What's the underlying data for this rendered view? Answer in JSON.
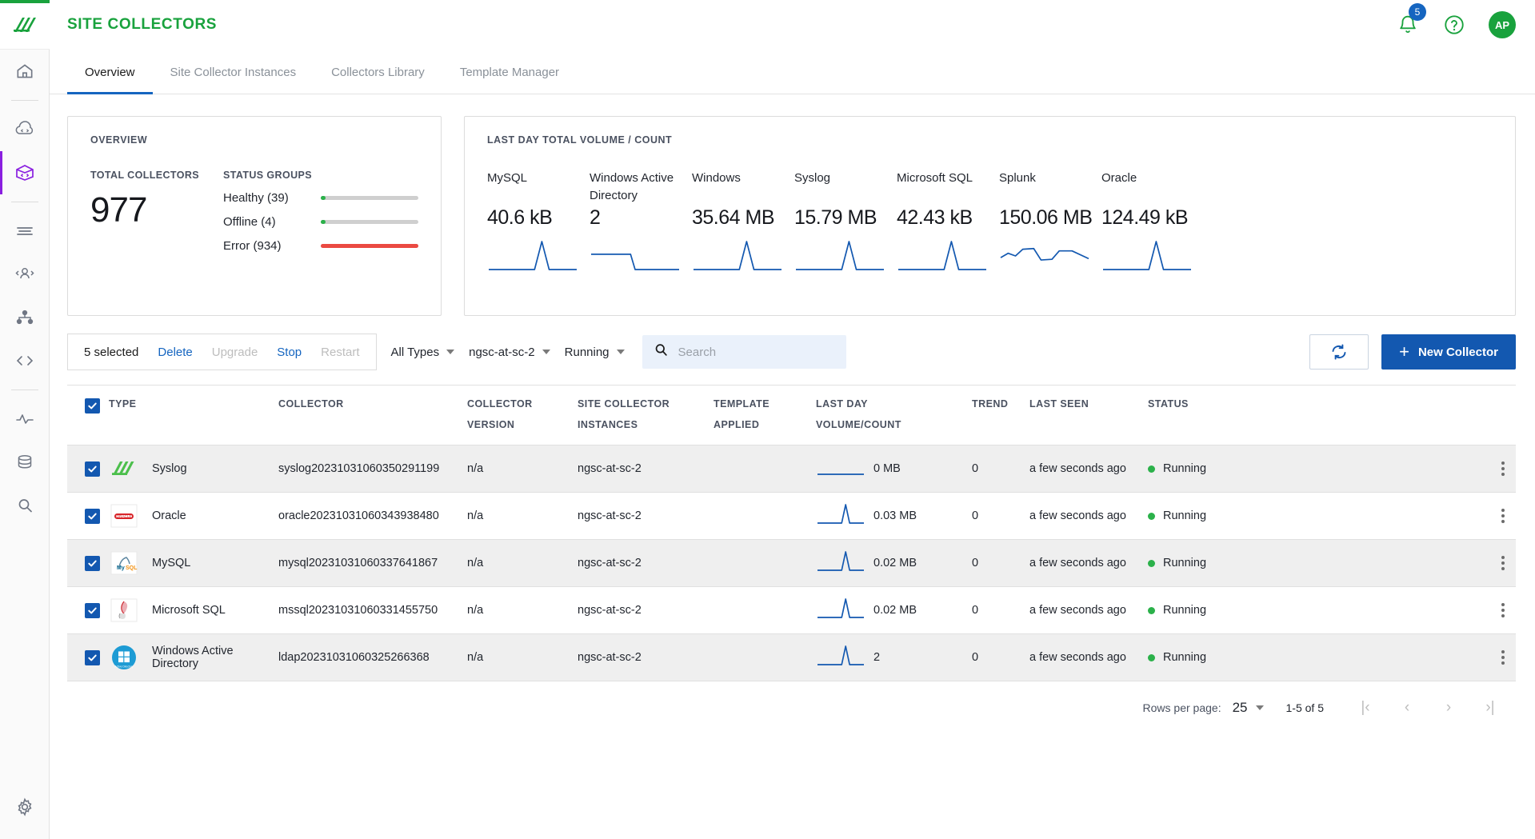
{
  "brand": {
    "accent_green": "#19a23d",
    "accent_blue": "#1358b0",
    "accent_purple": "#8a1fe0"
  },
  "header": {
    "title": "SITE COLLECTORS",
    "notification_count": "5",
    "avatar_initials": "AP",
    "bell_icon": "bell-icon",
    "help_icon": "help-circle-icon"
  },
  "sidebar": {
    "logo_icon": "logo-icon",
    "items": [
      {
        "icon": "home-icon",
        "name": "home",
        "active": false
      },
      {
        "icon": "cloud-code-icon",
        "name": "cloud",
        "active": false
      },
      {
        "icon": "box-code-icon",
        "name": "collectors",
        "active": true
      },
      {
        "icon": "list-lines-icon",
        "name": "logs",
        "active": false
      },
      {
        "icon": "users-icon",
        "name": "users",
        "active": false
      },
      {
        "icon": "topology-icon",
        "name": "topology",
        "active": false
      },
      {
        "icon": "code-brackets-icon",
        "name": "code",
        "active": false
      },
      {
        "icon": "pulse-icon",
        "name": "activity",
        "active": false
      },
      {
        "icon": "database-icon",
        "name": "database",
        "active": false
      },
      {
        "icon": "search-icon",
        "name": "search",
        "active": false
      }
    ],
    "settings_icon": "gear-icon"
  },
  "tabs": [
    {
      "label": "Overview",
      "active": true
    },
    {
      "label": "Site Collector Instances",
      "active": false
    },
    {
      "label": "Collectors Library",
      "active": false
    },
    {
      "label": "Template Manager",
      "active": false
    }
  ],
  "overview_card": {
    "title": "OVERVIEW",
    "total_label": "TOTAL COLLECTORS",
    "total_value": "977",
    "status_label": "STATUS GROUPS",
    "status_groups": [
      {
        "label": "Healthy (39)",
        "pct": 4,
        "color": "#2bb14a"
      },
      {
        "label": "Offline (4)",
        "pct": 0,
        "color": "#2bb14a"
      },
      {
        "label": "Error (934)",
        "pct": 100,
        "color": "#eb4a42"
      }
    ]
  },
  "volume_card": {
    "title": "LAST DAY TOTAL VOLUME / COUNT",
    "metrics": [
      {
        "name": "MySQL",
        "value": "40.6 kB"
      },
      {
        "name": "Windows Active Directory",
        "value": "2"
      },
      {
        "name": "Windows",
        "value": "35.64 MB"
      },
      {
        "name": "Syslog",
        "value": "15.79 MB"
      },
      {
        "name": "Microsoft SQL",
        "value": "42.43 kB"
      },
      {
        "name": "Splunk",
        "value": "150.06 MB"
      },
      {
        "name": "Oracle",
        "value": "124.49 kB"
      }
    ]
  },
  "toolbar": {
    "selected_text": "5 selected",
    "delete_label": "Delete",
    "upgrade_label": "Upgrade",
    "stop_label": "Stop",
    "restart_label": "Restart",
    "filter_type": "All Types",
    "filter_instance": "ngsc-at-sc-2",
    "filter_status": "Running",
    "search_placeholder": "Search",
    "search_value": "",
    "refresh_icon": "refresh-icon",
    "new_collector_label": "New Collector"
  },
  "table": {
    "headers": [
      {
        "main": "TYPE",
        "sub": ""
      },
      {
        "main": "COLLECTOR",
        "sub": ""
      },
      {
        "main": "COLLECTOR",
        "sub": "VERSION"
      },
      {
        "main": "SITE COLLECTOR",
        "sub": "INSTANCES"
      },
      {
        "main": "TEMPLATE",
        "sub": "APPLIED"
      },
      {
        "main": "LAST DAY",
        "sub": "VOLUME/COUNT"
      },
      {
        "main": "TREND",
        "sub": ""
      },
      {
        "main": "LAST SEEN",
        "sub": ""
      },
      {
        "main": "STATUS",
        "sub": ""
      }
    ],
    "rows": [
      {
        "checked": true,
        "icon": "syslog-logo-icon",
        "type": "Syslog",
        "collector": "syslog20231031060350291199",
        "version": "n/a",
        "instances": "ngsc-at-sc-2",
        "template": "",
        "last_day": "0 MB",
        "spark": "flat",
        "trend": "0",
        "last_seen": "a few seconds ago",
        "status": "Running"
      },
      {
        "checked": true,
        "icon": "oracle-logo-icon",
        "type": "Oracle",
        "collector": "oracle20231031060343938480",
        "version": "n/a",
        "instances": "ngsc-at-sc-2",
        "template": "",
        "last_day": "0.03 MB",
        "spark": "spike",
        "trend": "0",
        "last_seen": "a few seconds ago",
        "status": "Running"
      },
      {
        "checked": true,
        "icon": "mysql-logo-icon",
        "type": "MySQL",
        "collector": "mysql20231031060337641867",
        "version": "n/a",
        "instances": "ngsc-at-sc-2",
        "template": "",
        "last_day": "0.02 MB",
        "spark": "spike",
        "trend": "0",
        "last_seen": "a few seconds ago",
        "status": "Running"
      },
      {
        "checked": true,
        "icon": "mssql-logo-icon",
        "type": "Microsoft SQL",
        "collector": "mssql20231031060331455750",
        "version": "n/a",
        "instances": "ngsc-at-sc-2",
        "template": "",
        "last_day": "0.02 MB",
        "spark": "spike",
        "trend": "0",
        "last_seen": "a few seconds ago",
        "status": "Running"
      },
      {
        "checked": true,
        "icon": "windows-ad-logo-icon",
        "type": "Windows Active Directory",
        "collector": "ldap20231031060325266368",
        "version": "n/a",
        "instances": "ngsc-at-sc-2",
        "template": "",
        "last_day": "2",
        "spark": "spike",
        "trend": "0",
        "last_seen": "a few seconds ago",
        "status": "Running"
      }
    ]
  },
  "footer": {
    "rows_per_page_label": "Rows per page:",
    "rows_per_page_value": "25",
    "range": "1-5 of 5",
    "first_icon": "first-page-icon",
    "prev_icon": "prev-page-icon",
    "next_icon": "next-page-icon",
    "last_icon": "last-page-icon"
  }
}
